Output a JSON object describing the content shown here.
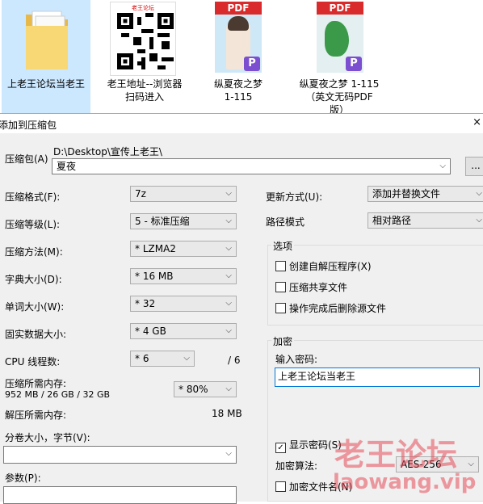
{
  "desktop": {
    "icons": [
      {
        "name": "folder-icon",
        "label": "上老王论坛当老王",
        "selected": true
      },
      {
        "name": "qrcode-icon",
        "label": "老王地址--浏览器扫码进入",
        "qr_caption": "老王论坛"
      },
      {
        "name": "pdf-icon",
        "label": "纵夏夜之梦 1-115",
        "badge": "PDF"
      },
      {
        "name": "pdf-icon",
        "label": "纵夏夜之梦 1-115（英文无码PDF版）",
        "badge": "PDF"
      }
    ]
  },
  "dialog": {
    "title": "添加到压缩包",
    "close": "×",
    "archive_label": "压缩包(A)",
    "archive_path": "D:\\Desktop\\宣传上老王\\",
    "archive_name": "夏夜",
    "browse_label": "...",
    "format_label": "压缩格式(F):",
    "format_value": "7z",
    "level_label": "压缩等级(L):",
    "level_value": "5 - 标准压缩",
    "method_label": "压缩方法(M):",
    "method_value": "*  LZMA2",
    "dict_label": "字典大小(D):",
    "dict_value": "*  16 MB",
    "word_label": "单词大小(W):",
    "word_value": "*  32",
    "solid_label": "固实数据大小:",
    "solid_value": "*  4 GB",
    "threads_label": "CPU 线程数:",
    "threads_value": "*  6",
    "threads_total": "/ 6",
    "mem_label": "压缩所需内存:",
    "mem_value": "952 MB / 26 GB / 32 GB",
    "mem_percent": "*  80%",
    "decomp_label": "解压所需内存:",
    "decomp_value": "18 MB",
    "split_label": "分卷大小，字节(V):",
    "params_label": "参数(P):",
    "update_label": "更新方式(U):",
    "update_value": "添加并替换文件",
    "path_label": "路径模式",
    "path_value": "相对路径",
    "options_title": "选项",
    "opt_sfx": "创建自解压程序(X)",
    "opt_shared": "压缩共享文件",
    "opt_delete": "操作完成后删除源文件",
    "encrypt_title": "加密",
    "password_label": "输入密码:",
    "password_value": "上老王论坛当老王",
    "show_password": "显示密码(S)",
    "show_password_checked": true,
    "algo_label": "加密算法:",
    "algo_value": "AES-256",
    "encrypt_names": "加密文件名(N)"
  },
  "watermark": {
    "text1": "老王论坛",
    "text2": "laowang.vip"
  }
}
